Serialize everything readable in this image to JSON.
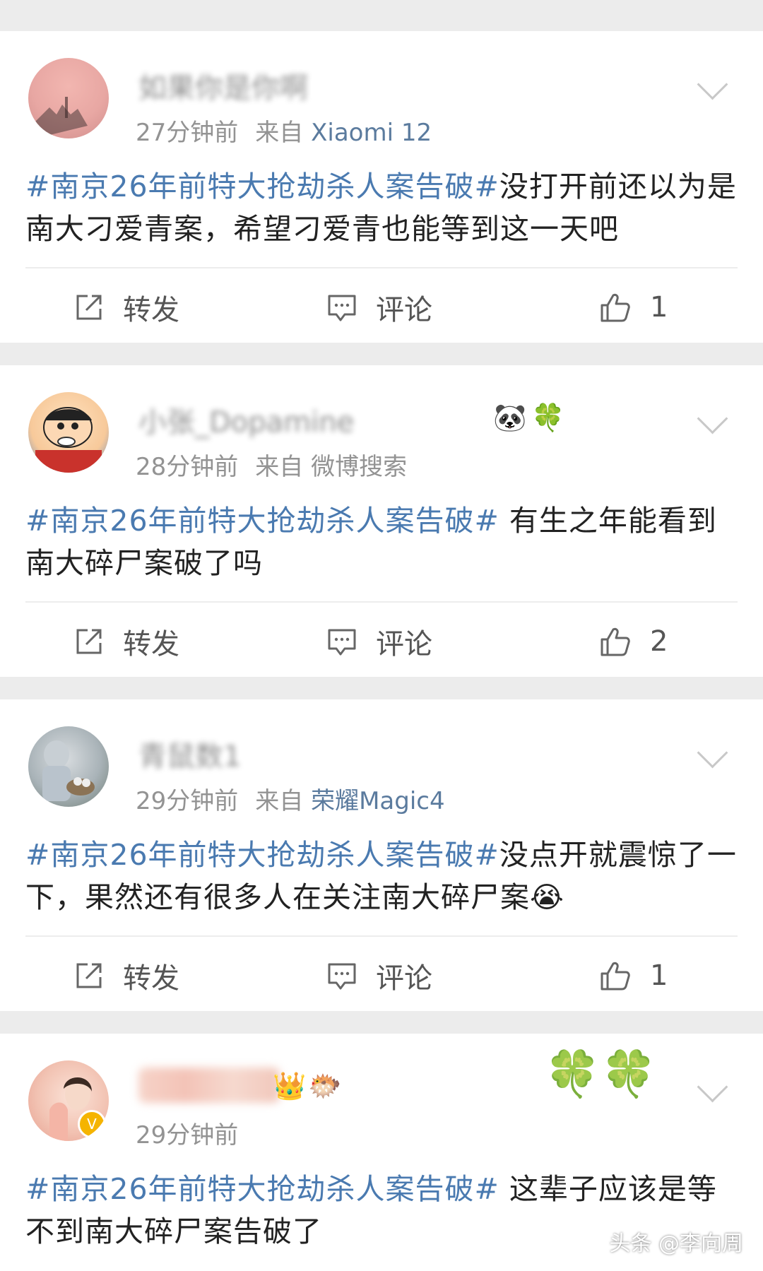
{
  "posts": [
    {
      "name": "如果你是你啊",
      "time": "27分钟前",
      "source_prefix": "来自",
      "source": "Xiaomi 12",
      "hashtag": "#南京26年前特大抢劫杀人案告破#",
      "body": "没打开前还以为是南大刁爱青案，希望刁爱青也能等到这一天吧",
      "share_label": "转发",
      "comment_label": "评论",
      "likes": "1"
    },
    {
      "name": "小张_Dopamine",
      "name_badges": [
        "🐼",
        "🍀"
      ],
      "time": "28分钟前",
      "source_prefix": "来自",
      "source": "微博搜索",
      "hashtag": "#南京26年前特大抢劫杀人案告破#",
      "body": " 有生之年能看到南大碎尸案破了吗",
      "share_label": "转发",
      "comment_label": "评论",
      "likes": "2"
    },
    {
      "name": "青鼠数1",
      "time": "29分钟前",
      "source_prefix": "来自",
      "source": "荣耀Magic4",
      "hashtag": "#南京26年前特大抢劫杀人案告破#",
      "body": "没点开就震惊了一下，果然还有很多人在关注南大碎尸案😭",
      "share_label": "转发",
      "comment_label": "评论",
      "likes": "1"
    },
    {
      "name": "",
      "name_badges": [
        "👑",
        "🐡"
      ],
      "time": "29分钟前",
      "hashtag": "#南京26年前特大抢劫杀人案告破#",
      "body": " 这辈子应该是等不到南大碎尸案告破了",
      "verified_mark": "V",
      "decoration": "🍀🍀"
    }
  ],
  "watermark": "头条 @李向周",
  "colors": {
    "hashtag": "#4a7ab0",
    "source_link": "#5b7b9e",
    "meta_gray": "#939393",
    "background": "#ececec"
  },
  "icons": {
    "share": "share-icon",
    "comment": "comment-icon",
    "like": "thumbs-up-icon",
    "more": "chevron-down-icon"
  }
}
